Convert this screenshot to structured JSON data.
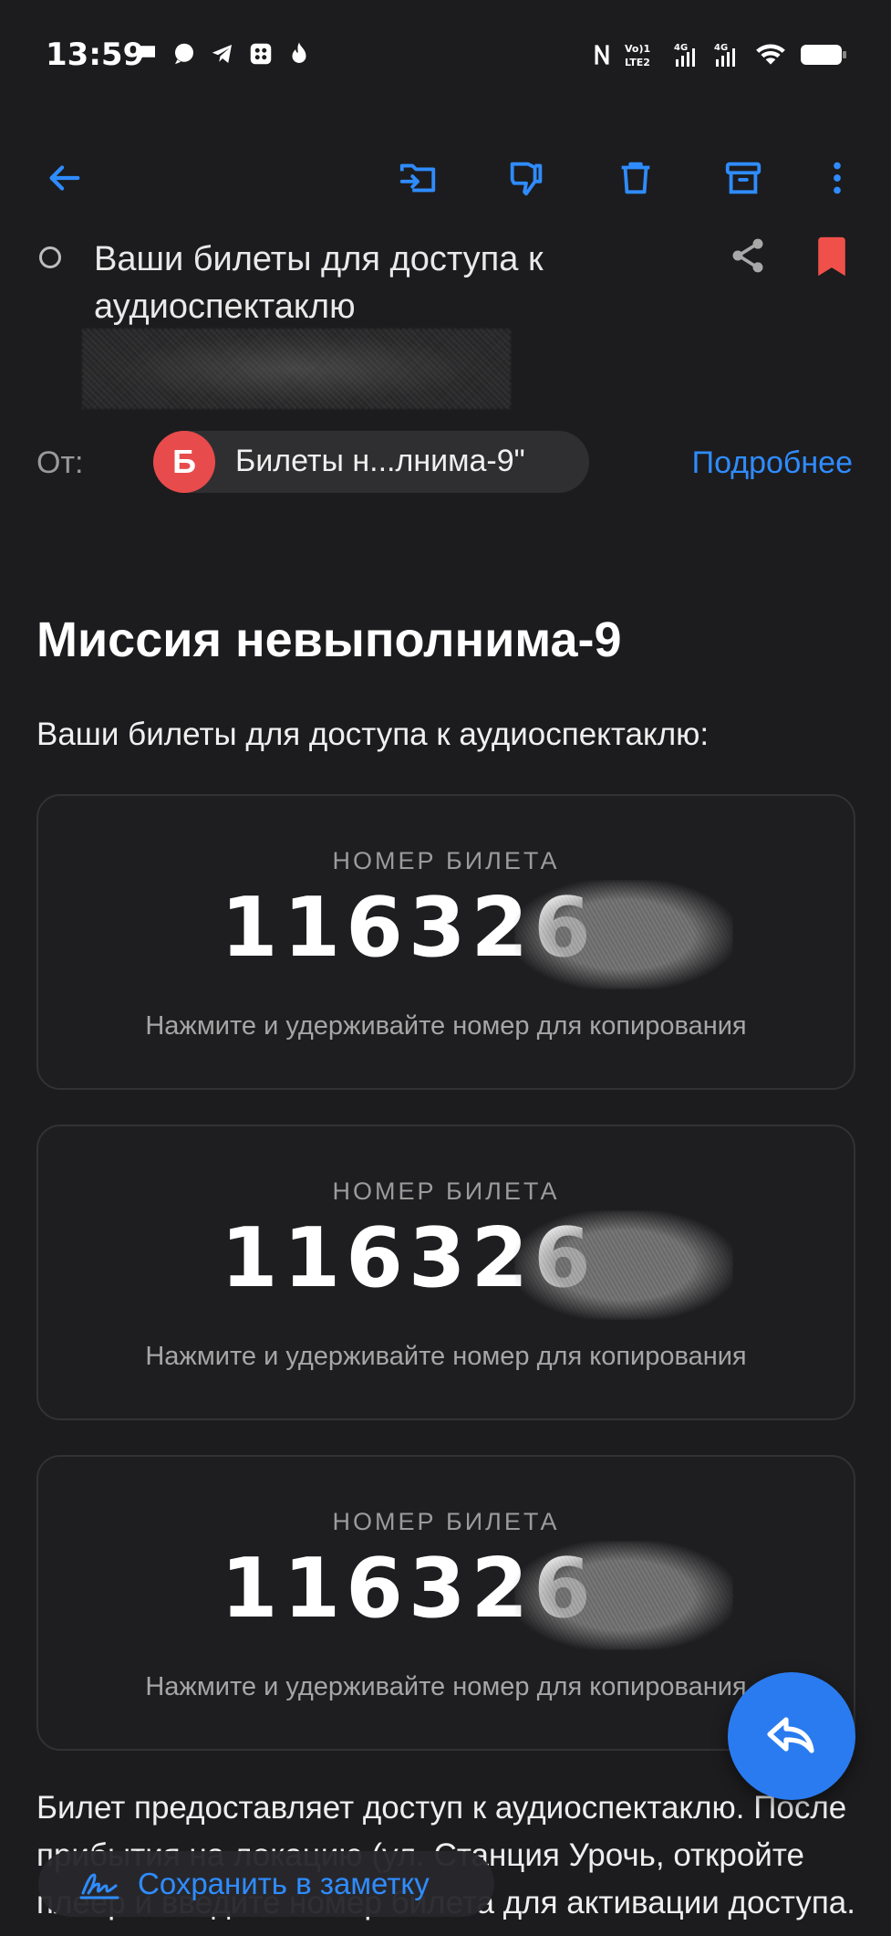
{
  "status_bar": {
    "time": "13:59"
  },
  "toolbar": {
    "back": "back-arrow-icon",
    "move": "move-to-folder-icon",
    "dislike": "thumbs-down-icon",
    "delete": "trash-icon",
    "archive": "archive-icon",
    "more": "more-vertical-icon"
  },
  "message": {
    "subject": "Ваши билеты для доступа к аудиоспектаклю",
    "from_label": "От:",
    "sender_initial": "Б",
    "sender_name": "Билеты н...лнима-9\"",
    "details_link": "Подробнее"
  },
  "body": {
    "title": "Миссия невыполнима-9",
    "intro": "Ваши билеты для доступа к аудиоспектаклю:",
    "tickets": [
      {
        "label": "НОМЕР БИЛЕТА",
        "number": "116326",
        "hint": "Нажмите и удерживайте номер для копирования"
      },
      {
        "label": "НОМЕР БИЛЕТА",
        "number": "116326",
        "hint": "Нажмите и удерживайте номер для копирования"
      },
      {
        "label": "НОМЕР БИЛЕТА",
        "number": "116326",
        "hint": "Нажмите и удерживайте номер для копирования"
      }
    ],
    "footer": "Билет предоставляет доступ к аудиоспектаклю. После прибытия на локацию (ул. Станция Урочь, откройте плеер и введите номер билета для активации доступа."
  },
  "actions": {
    "save_note": "Сохранить в заметку",
    "reply": "reply-icon"
  },
  "colors": {
    "background": "#1c1c1e",
    "accent": "#2f8cff",
    "avatar": "#e84b4b",
    "bookmark": "#f0504a",
    "fab": "#2a7bf0"
  }
}
